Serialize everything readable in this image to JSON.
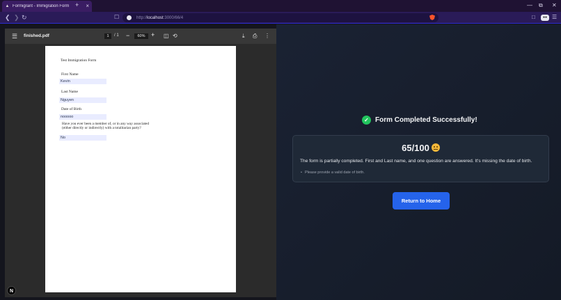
{
  "browser": {
    "tab_title": "Formigrant - Immigration Form",
    "tab_close": "×",
    "new_tab": "+",
    "url_prefix": "http://",
    "url_host": "localhost",
    "url_path": ":3000/66/4",
    "window": {
      "minimize": "—",
      "restore": "⧉",
      "close": "✕"
    }
  },
  "pdf": {
    "filename": "finished.pdf",
    "page_current": "1",
    "page_total": "/   1",
    "zoom": "60%",
    "zoom_out": "−",
    "zoom_in": "+",
    "document": {
      "title": "Test Immigration Form",
      "first_name_label": "First Name",
      "first_name_value": "Kevin",
      "last_name_label": "Last Name",
      "last_name_value": "Nguyen",
      "dob_label": "Date of Birth",
      "dob_value": "nooooo",
      "question_line1": "Have you ever been a member of, or in any way associated",
      "question_line2": "(either directly or indirectly) with a totalitarian party?",
      "question_value": "No"
    }
  },
  "next_badge": "N",
  "result": {
    "heading": "Form Completed Successfully!",
    "score": "65/100",
    "feedback": "The form is partially completed. First and Last name, and one question are answered. It's missing the date of birth.",
    "bullets": [
      "Please provide a valid date of birth."
    ],
    "button_label": "Return to Home",
    "accent_color": "#2563eb",
    "success_color": "#22c55e"
  }
}
